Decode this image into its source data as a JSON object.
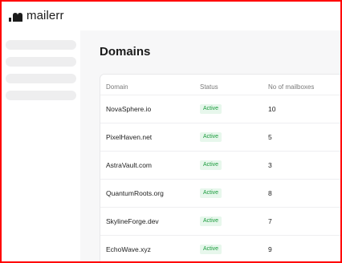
{
  "app": {
    "name": "mailerr"
  },
  "page": {
    "title": "Domains"
  },
  "table": {
    "headers": {
      "domain": "Domain",
      "status": "Status",
      "mailboxes": "No of mailboxes"
    },
    "rows": [
      {
        "domain": "NovaSphere.io",
        "status": "Active",
        "mailboxes": "10"
      },
      {
        "domain": "PixelHaven.net",
        "status": "Active",
        "mailboxes": "5"
      },
      {
        "domain": "AstraVault.com",
        "status": "Active",
        "mailboxes": "3"
      },
      {
        "domain": "QuantumRoots.org",
        "status": "Active",
        "mailboxes": "8"
      },
      {
        "domain": "SkylineForge.dev",
        "status": "Active",
        "mailboxes": "7"
      },
      {
        "domain": "EchoWave.xyz",
        "status": "Active",
        "mailboxes": "9"
      }
    ]
  },
  "colors": {
    "active_text": "#1a9b3c",
    "active_bg": "#e7f7ec",
    "frame": "#ff0000"
  }
}
